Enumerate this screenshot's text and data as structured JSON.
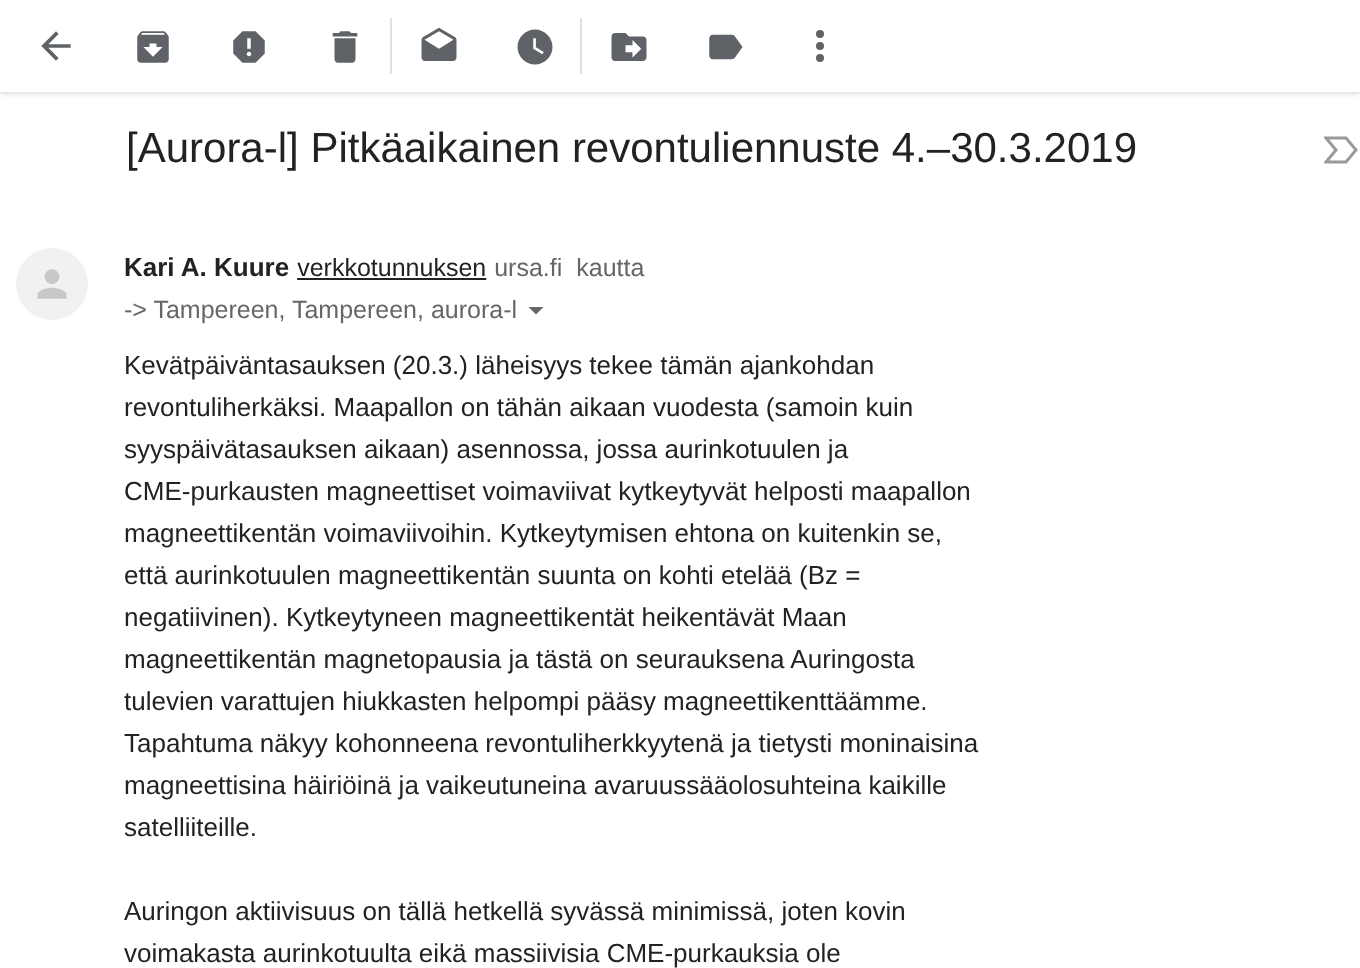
{
  "toolbar": {
    "buttons": [
      {
        "kind": "back"
      },
      {
        "kind": "archive"
      },
      {
        "kind": "spam"
      },
      {
        "kind": "delete"
      },
      {
        "kind": "divider"
      },
      {
        "kind": "unread"
      },
      {
        "kind": "snooze"
      },
      {
        "kind": "divider"
      },
      {
        "kind": "move"
      },
      {
        "kind": "label"
      },
      {
        "kind": "more"
      }
    ]
  },
  "subject": "[Aurora-l] Pitkäaikainen revontuliennuste 4.–30.3.2019",
  "sender": {
    "name": "Kari A. Kuure",
    "via_link": "verkkotunnuksen",
    "domain": "ursa.fi",
    "via": "kautta",
    "recipients": "-> Tampereen, Tampereen, aurora-l"
  },
  "body": [
    {
      "lines": [
        "Kevätpäiväntasauksen (20.3.) läheisyys tekee tämän ajankohdan",
        "revontuliherkäksi. Maapallon on tähän aikaan vuodesta (samoin kuin",
        "syyspäivätasauksen aikaan) asennossa, jossa aurinkotuulen ja",
        "CME-purkausten magneettiset voimaviivat kytkeytyvät helposti maapallon",
        "magneettikentän voimaviivoihin. Kytkeytymisen ehtona on kuitenkin se,",
        "että aurinkotuulen magneettikentän suunta on kohti etelää (Bz =",
        "negatiivinen). Kytkeytyneen magneettikentät heikentävät Maan",
        "magneettikentän magnetopausia ja tästä on seurauksena Auringosta",
        "tulevien varattujen hiukkasten helpompi pääsy magneettikenttäämme.",
        "Tapahtuma näkyy kohonneena revontuliherkkyytenä ja tietysti moninaisina",
        "magneettisina häiriöinä ja vaikeutuneina avaruussääolosuhteina kaikille",
        "satelliiteille."
      ]
    },
    {
      "lines": [
        "Auringon aktiivisuus on tällä hetkellä syvässä minimissä, joten kovin",
        "voimakasta aurinkotuulta eikä massiivisia CME-purkauksia ole"
      ]
    }
  ]
}
